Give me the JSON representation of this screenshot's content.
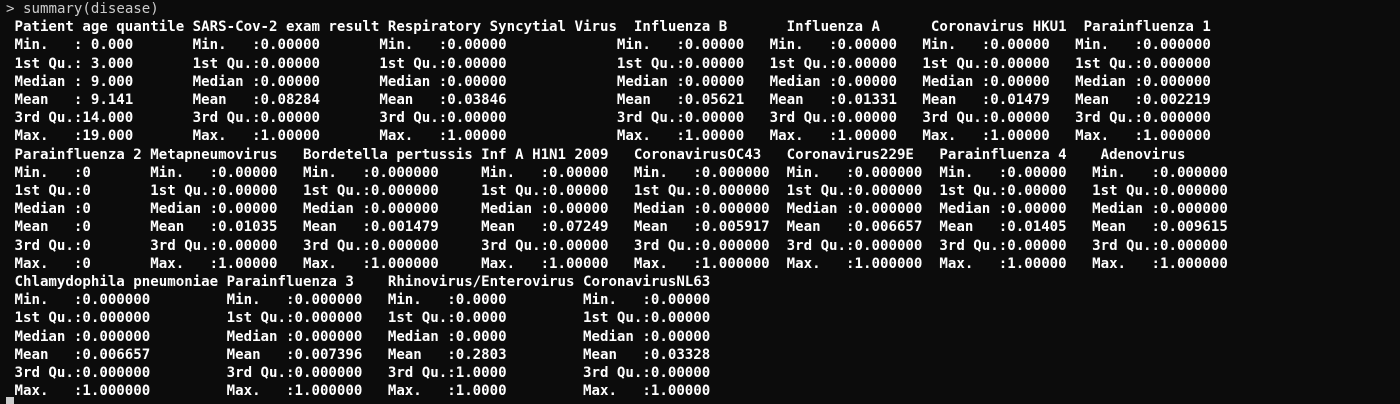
{
  "console": {
    "prompt": ">",
    "command": "summary(disease)",
    "output_lines": [
      " Patient age quantile SARS-Cov-2 exam result Respiratory Syncytial Virus  Influenza B       Influenza A      Coronavirus HKU1  Parainfluenza 1",
      " Min.   : 0.000       Min.   :0.00000       Min.   :0.00000             Min.   :0.00000   Min.   :0.00000   Min.   :0.00000   Min.   :0.000000",
      " 1st Qu.: 3.000       1st Qu.:0.00000       1st Qu.:0.00000             1st Qu.:0.00000   1st Qu.:0.00000   1st Qu.:0.00000   1st Qu.:0.000000",
      " Median : 9.000       Median :0.00000       Median :0.00000             Median :0.00000   Median :0.00000   Median :0.00000   Median :0.000000",
      " Mean   : 9.141       Mean   :0.08284       Mean   :0.03846             Mean   :0.05621   Mean   :0.01331   Mean   :0.01479   Mean   :0.002219",
      " 3rd Qu.:14.000       3rd Qu.:0.00000       3rd Qu.:0.00000             3rd Qu.:0.00000   3rd Qu.:0.00000   3rd Qu.:0.00000   3rd Qu.:0.000000",
      " Max.   :19.000       Max.   :1.00000       Max.   :1.00000             Max.   :1.00000   Max.   :1.00000   Max.   :1.00000   Max.   :1.000000",
      " Parainfluenza 2 Metapneumovirus   Bordetella pertussis Inf A H1N1 2009   CoronavirusOC43   Coronavirus229E   Parainfluenza 4    Adenovirus",
      " Min.   :0       Min.   :0.00000   Min.   :0.000000     Min.   :0.00000   Min.   :0.000000  Min.   :0.000000  Min.   :0.00000   Min.   :0.000000",
      " 1st Qu.:0       1st Qu.:0.00000   1st Qu.:0.000000     1st Qu.:0.00000   1st Qu.:0.000000  1st Qu.:0.000000  1st Qu.:0.00000   1st Qu.:0.000000",
      " Median :0       Median :0.00000   Median :0.000000     Median :0.00000   Median :0.000000  Median :0.000000  Median :0.00000   Median :0.000000",
      " Mean   :0       Mean   :0.01035   Mean   :0.001479     Mean   :0.07249   Mean   :0.005917  Mean   :0.006657  Mean   :0.01405   Mean   :0.009615",
      " 3rd Qu.:0       3rd Qu.:0.00000   3rd Qu.:0.000000     3rd Qu.:0.00000   3rd Qu.:0.000000  3rd Qu.:0.000000  3rd Qu.:0.00000   3rd Qu.:0.000000",
      " Max.   :0       Max.   :1.00000   Max.   :1.000000     Max.   :1.00000   Max.   :1.000000  Max.   :1.000000  Max.   :1.00000   Max.   :1.000000",
      " Chlamydophila pneumoniae Parainfluenza 3    Rhinovirus/Enterovirus CoronavirusNL63",
      " Min.   :0.000000         Min.   :0.000000   Min.   :0.0000         Min.   :0.00000",
      " 1st Qu.:0.000000         1st Qu.:0.000000   1st Qu.:0.0000         1st Qu.:0.00000",
      " Median :0.000000         Median :0.000000   Median :0.0000         Median :0.00000",
      " Mean   :0.006657         Mean   :0.007396   Mean   :0.2803         Mean   :0.03328",
      " 3rd Qu.:0.000000         3rd Qu.:0.000000   3rd Qu.:1.0000         3rd Qu.:0.00000",
      " Max.   :1.000000         Max.   :1.000000   Max.   :1.0000         Max.   :1.00000"
    ]
  },
  "colors": {
    "background": "#0c0c0c",
    "prompt_text": "#cccccc",
    "output_text": "#ffffff"
  }
}
